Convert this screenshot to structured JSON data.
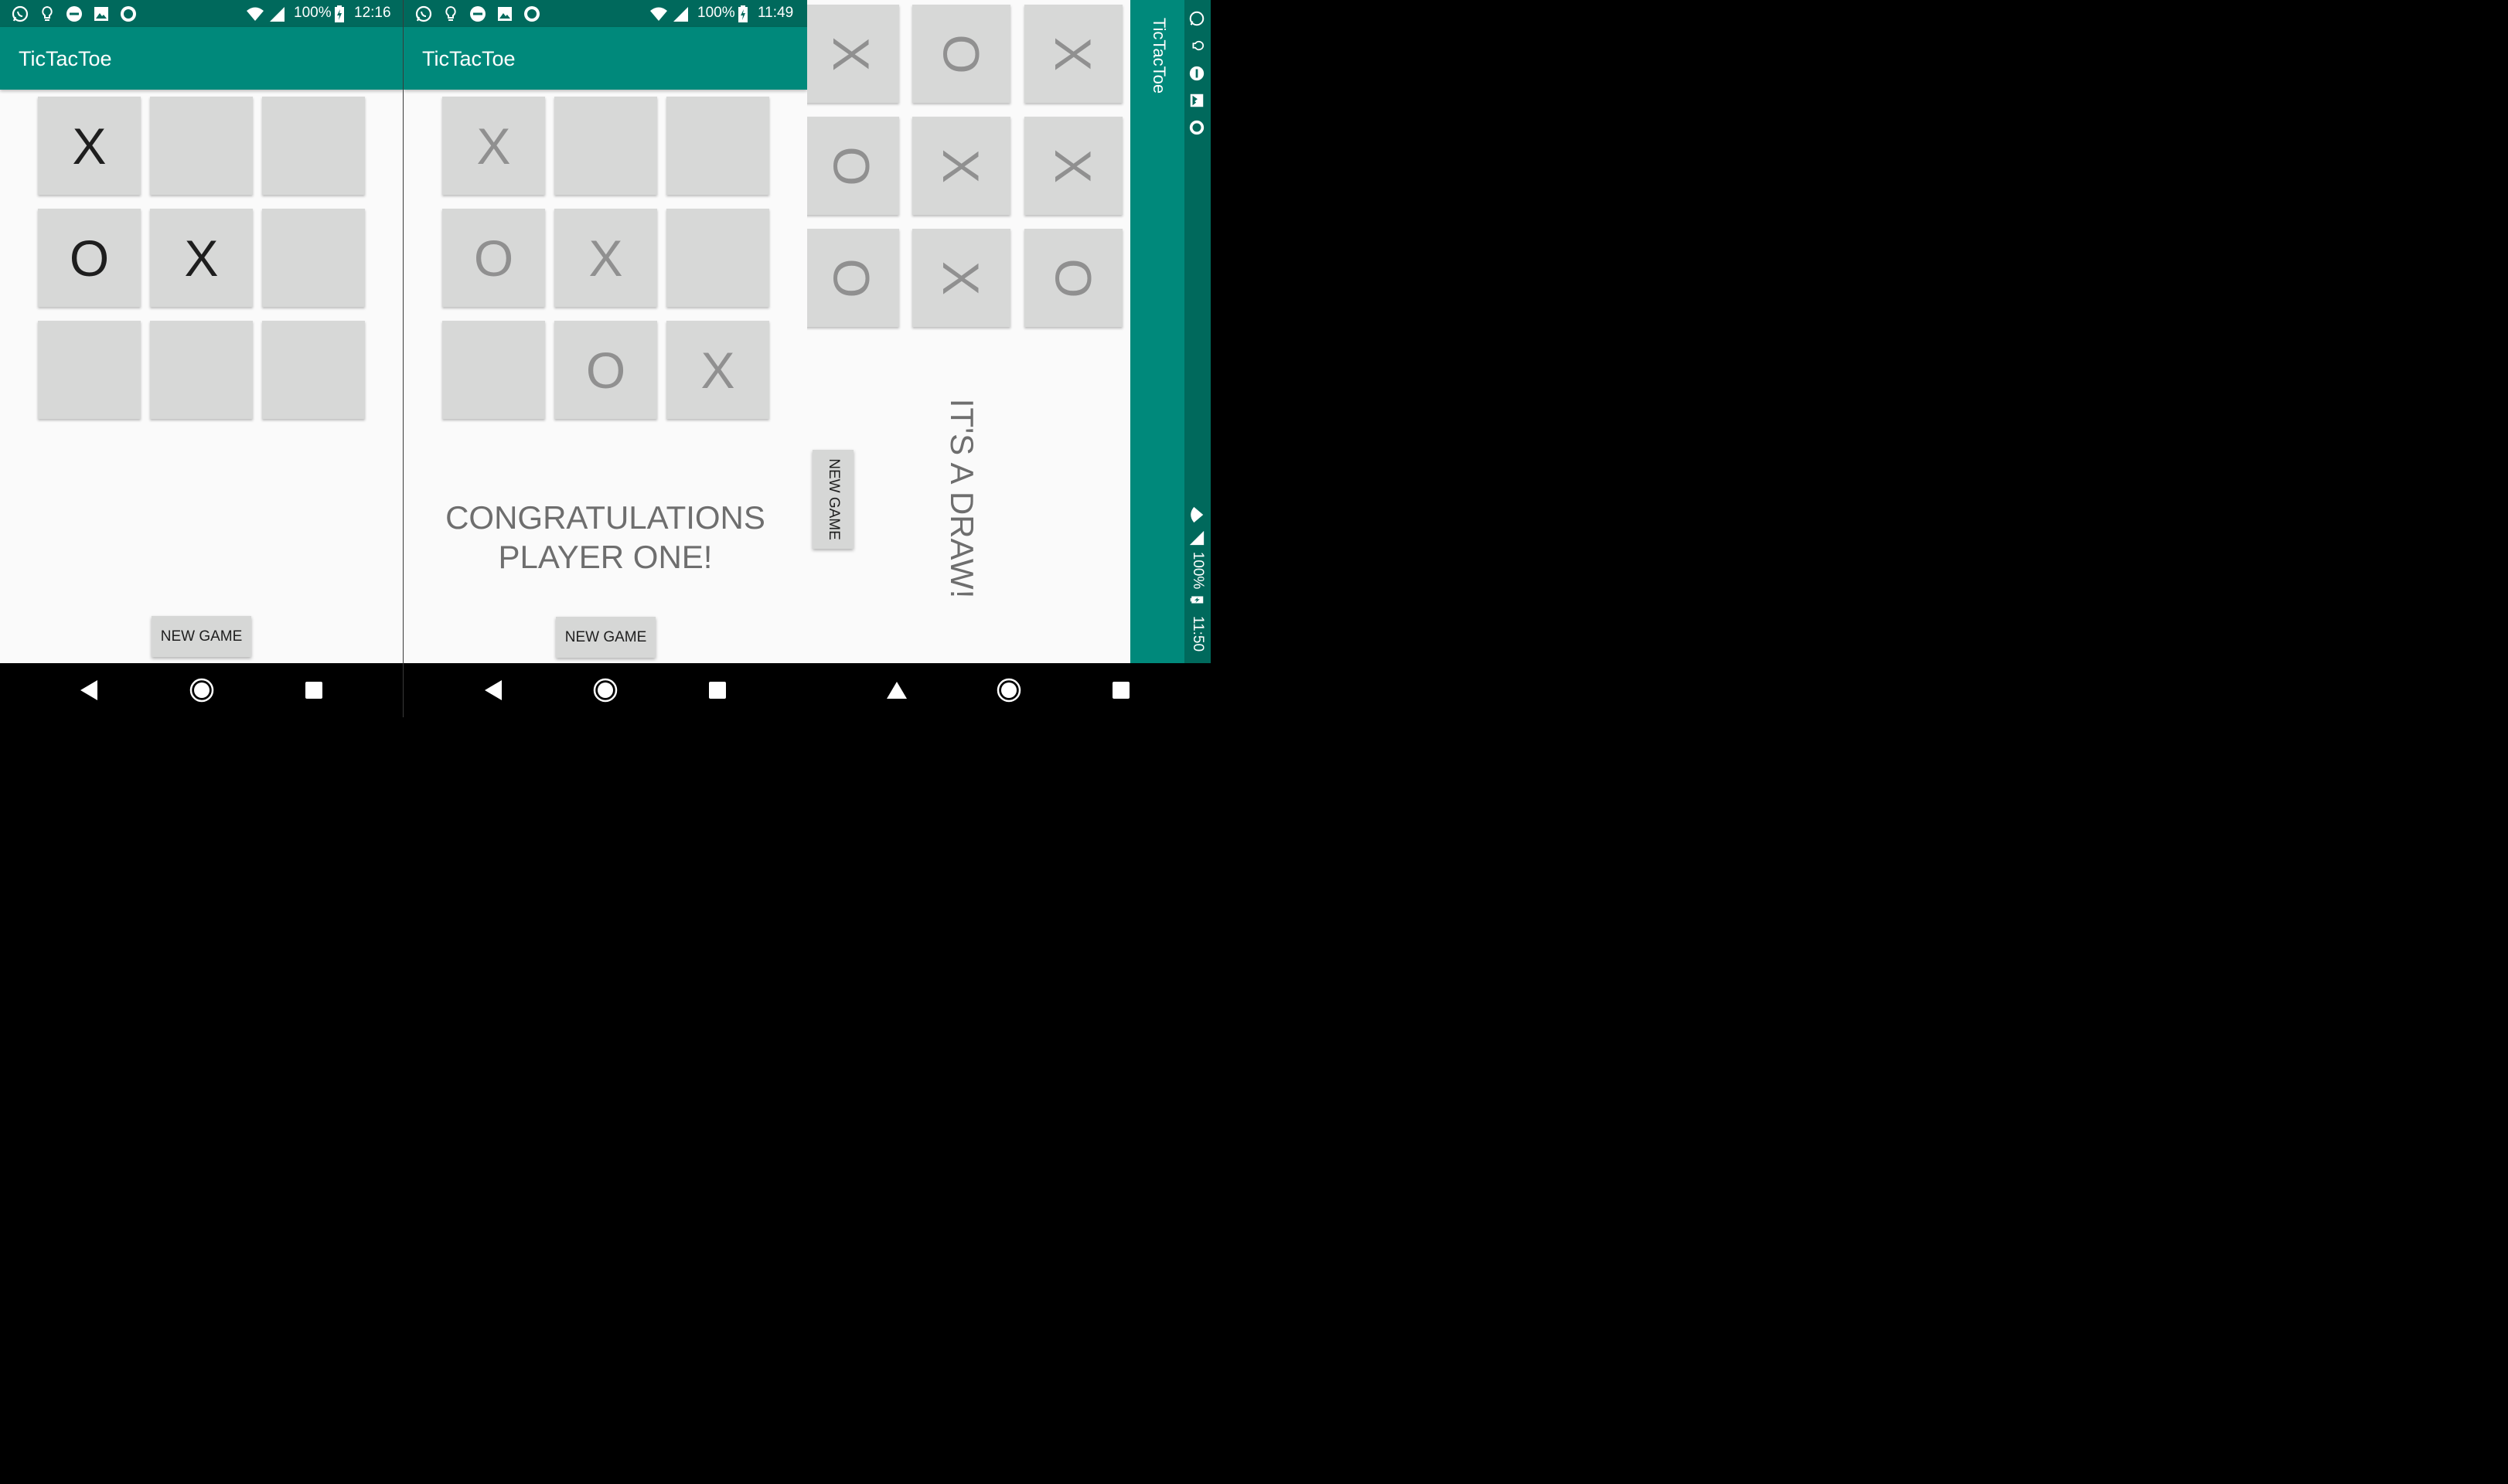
{
  "colors": {
    "statusbar": "#00695c",
    "appbar": "#00897b",
    "cell": "#d7d8d7",
    "mark_active": "#1e1e1e",
    "mark_finished": "#909090",
    "message": "#6e6e6e"
  },
  "screen1": {
    "status": {
      "battery": "100%",
      "time": "12:16"
    },
    "app_title": "TicTacToe",
    "board": [
      "X",
      "",
      "",
      "O",
      "X",
      "",
      "",
      "",
      ""
    ],
    "new_game_label": "NEW GAME"
  },
  "screen2": {
    "status": {
      "battery": "100%",
      "time": "11:49"
    },
    "app_title": "TicTacToe",
    "board": [
      "X",
      "",
      "",
      "O",
      "X",
      "",
      "",
      "O",
      "X"
    ],
    "message_line1": "CONGRATULATIONS",
    "message_line2": "PLAYER ONE!",
    "new_game_label": "NEW GAME"
  },
  "screen3": {
    "status": {
      "battery": "100%",
      "time": "11:50"
    },
    "app_title": "TicTacToe",
    "board": [
      "X",
      "O",
      "X",
      "O",
      "X",
      "X",
      "O",
      "X",
      "O"
    ],
    "message": "IT'S A DRAW!",
    "new_game_label": "NEW GAME"
  },
  "icons": {
    "status_left": [
      "whatsapp-icon",
      "lightbulb-icon",
      "do-not-disturb-icon",
      "image-icon",
      "record-icon"
    ],
    "status_right": [
      "wifi-icon",
      "signal-icon",
      "battery-charging-icon"
    ],
    "nav": [
      "back-icon",
      "home-icon",
      "recents-icon"
    ]
  }
}
